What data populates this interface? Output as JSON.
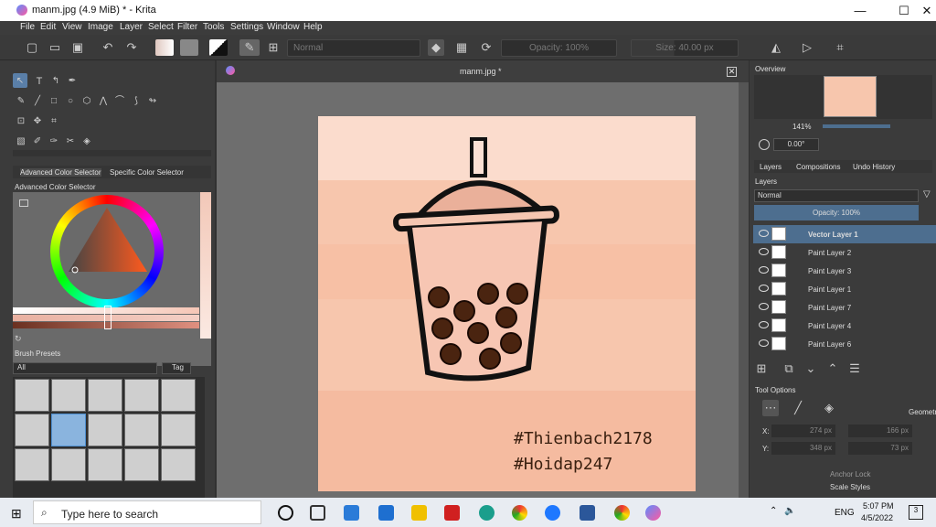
{
  "window": {
    "title": "manm.jpg (4.9 MiB)  * - Krita",
    "min": "—",
    "max": "☐",
    "close": "✕"
  },
  "menu": [
    "File",
    "Edit",
    "View",
    "Image",
    "Layer",
    "Select",
    "Filter",
    "Tools",
    "Settings",
    "Window",
    "Help"
  ],
  "toolbar": {
    "blend_mode": "Normal",
    "opacity": "Opacity: 100%",
    "size": "Size: 40.00 px"
  },
  "left": {
    "tab_advanced": "Advanced Color Selector",
    "tab_specific": "Specific Color Selector",
    "panel_title": "Advanced Color Selector",
    "brush_presets": "Brush Presets",
    "filter_all": "All",
    "tag": "Tag"
  },
  "document": {
    "tab_label": "manm.jpg *",
    "hashtag1": "#Thienbach2178",
    "hashtag2": "#Hoidap247"
  },
  "right": {
    "overview": "Overview",
    "zoom": "141%",
    "angle": "0.00°",
    "tabs": [
      "Layers",
      "Compositions",
      "Undo History"
    ],
    "layers_title": "Layers",
    "blend": "Normal",
    "opacity": "Opacity:  100%",
    "layers": [
      "Vector Layer 1",
      "Paint Layer 2",
      "Paint Layer 3",
      "Paint Layer 1",
      "Paint Layer 7",
      "Paint Layer 4",
      "Paint Layer 6"
    ],
    "tool_options": "Tool Options",
    "geometry": "Geometr",
    "x_label": "X:",
    "y_label": "Y:",
    "x1": "274 px",
    "x2": "166 px",
    "y1": "348 px",
    "y2": "73 px",
    "anchor_lock": "Anchor Lock",
    "scale_styles": "Scale Styles"
  },
  "taskbar": {
    "search": "Type here to search",
    "lang": "ENG",
    "time": "5:07 PM",
    "date": "4/5/2022",
    "notif": "3"
  },
  "colors": {
    "canvas_bg": "#f7c6ad",
    "accent": "#4d6e8f"
  }
}
